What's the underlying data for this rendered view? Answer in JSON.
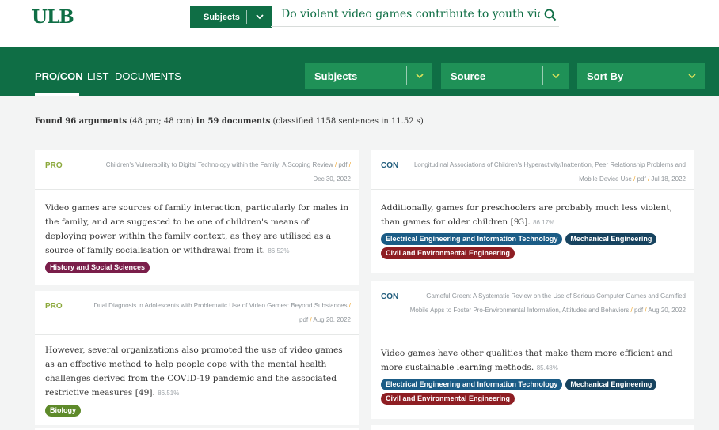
{
  "header": {
    "logo": "ULB",
    "subjects_button": "Subjects",
    "search_value": "Do violent video games contribute to youth violence"
  },
  "nav": {
    "tabs": [
      "PRO/CON",
      "LIST",
      "DOCUMENTS"
    ],
    "active_tab": "PRO/CON",
    "dropdowns": [
      "Subjects",
      "Source",
      "Sort By"
    ]
  },
  "summary": {
    "found": "Found 96 arguments",
    "counts": " (48 pro; 48 con) ",
    "in_docs": "in 59 documents",
    "classified": " (classified 1158 sentences in 11.52 s)"
  },
  "cards": [
    {
      "stance": "PRO",
      "source_title": "Children's Vulnerability to Digital Technology within the Family: A Scoping Review",
      "source_type": "pdf",
      "source_date": "Dec 30, 2022",
      "text": "Video games are sources of family interaction, particularly for males in the family, and are suggested to be one of children's means of deploying power within the family context, as they are utilised as a source of family socialisation or withdrawal from it.",
      "confidence": "86.52%",
      "tags": [
        "History and Social Sciences"
      ]
    },
    {
      "stance": "PRO",
      "source_title": "Dual Diagnosis in Adolescents with Problematic Use of Video Games: Beyond Substances",
      "source_type": "pdf",
      "source_date": "Aug 20, 2022",
      "text": "However, several organizations also promoted the use of video games as an effective method to help people cope with the mental health challenges derived from the COVID-19 pandemic and the associated restrictive measures [49].",
      "confidence": "86.51%",
      "tags": [
        "Biology"
      ]
    },
    {
      "stance": "CON",
      "source_title": "Longitudinal Associations of Children's Hyperactivity/Inattention, Peer Relationship Problems and Mobile Device Use",
      "source_type": "pdf",
      "source_date": "Jul 18, 2022",
      "text": "Additionally, games for preschoolers are probably much less violent, than games for older children [93].",
      "confidence": "86.17%",
      "tags": [
        "Electrical Engineering and Information Technology",
        "Mechanical Engineering",
        "Civil and Environmental Engineering"
      ]
    },
    {
      "stance": "CON",
      "source_title": "Gameful Green: A Systematic Review on the Use of Serious Computer Games and Gamified Mobile Apps to Foster Pro-Environmental Information, Attitudes and Behaviors",
      "source_type": "pdf",
      "source_date": "Aug 20, 2022",
      "text": "Video games have other qualities that make them more efficient and more sustainable learning methods.",
      "confidence": "85.48%",
      "tags": [
        "Electrical Engineering and Information Technology",
        "Mechanical Engineering",
        "Civil and Environmental Engineering"
      ]
    }
  ],
  "tag_colors": {
    "History and Social Sciences": "#7a1e4a",
    "Biology": "#5e8a2a",
    "Electrical Engineering and Information Technology": "#1b5c86",
    "Mechanical Engineering": "#17435f",
    "Civil and Environmental Engineering": "#8e1e23"
  },
  "colors": {
    "brand_green": "#0f6e45",
    "dropdown_green": "#1f9157",
    "pro": "#8ba83a",
    "con": "#1d5a7a"
  }
}
